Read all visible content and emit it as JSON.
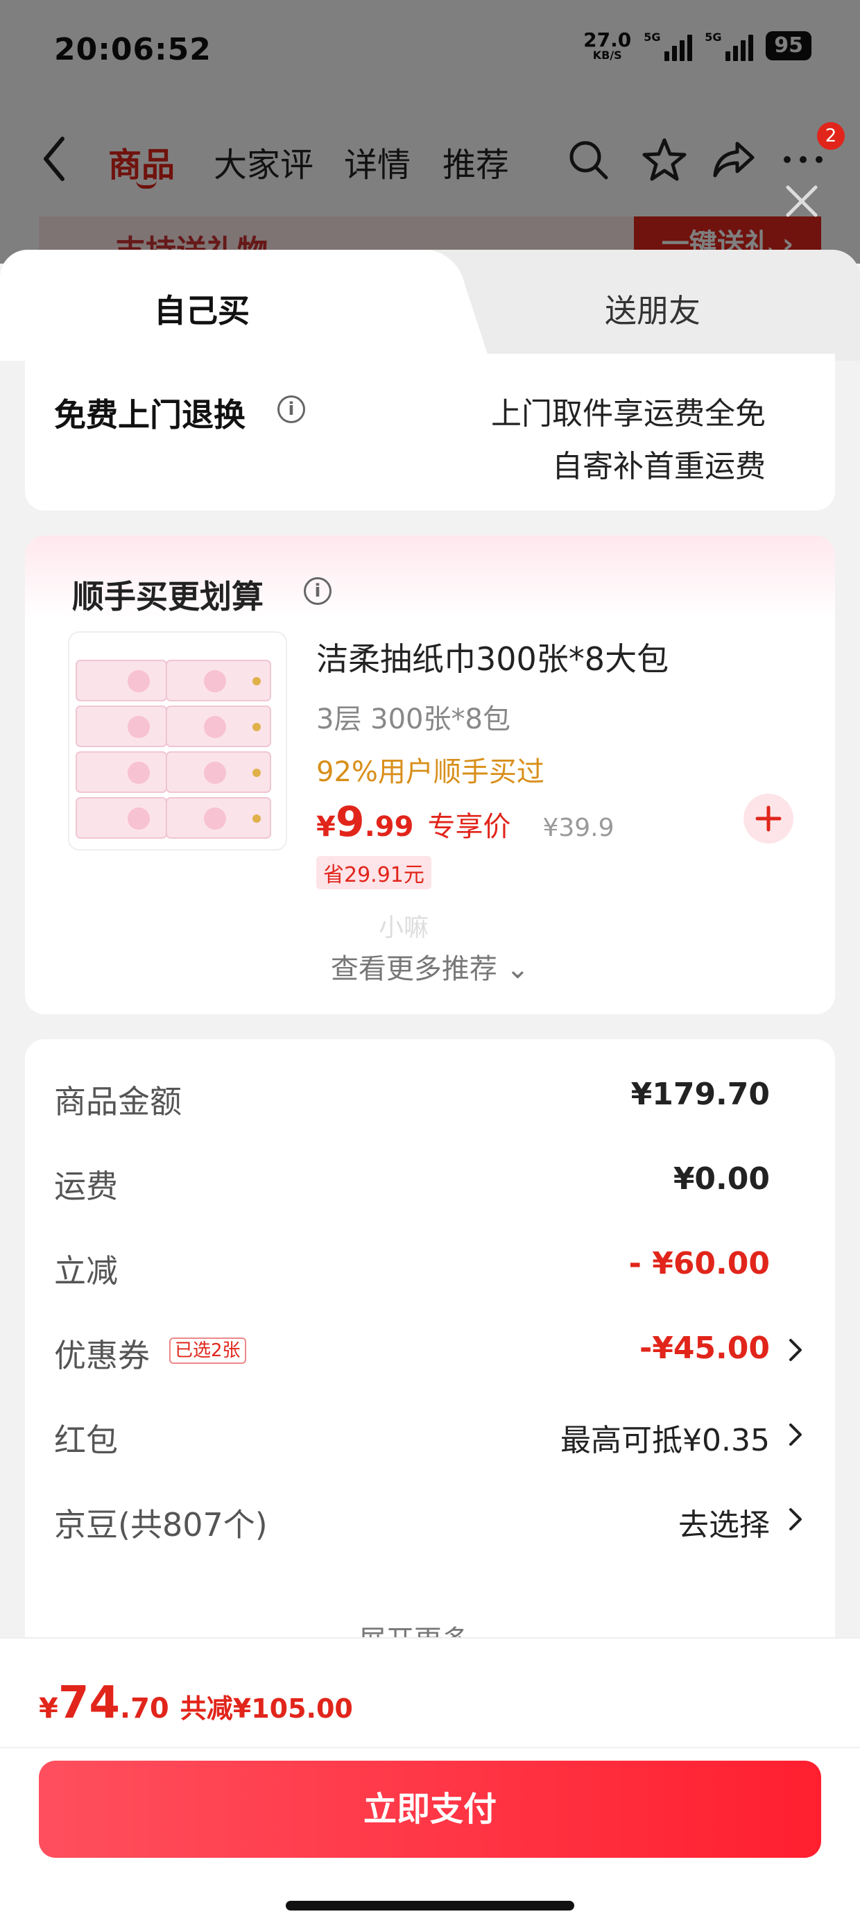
{
  "status_bar": {
    "time": "20:06:52",
    "net_speed": "27.0",
    "net_unit": "KB/S",
    "sim1": "5G",
    "sim2": "5G",
    "battery": "95"
  },
  "nav": {
    "tabs": [
      "商品",
      "大家评",
      "详情",
      "推荐"
    ],
    "active_tab": "商品",
    "badge_count": "2"
  },
  "gift_banner": {
    "label": "支持送礼物",
    "button": "一键送礼 ›"
  },
  "sheet_tabs": {
    "self_buy": "自己买",
    "gift_friend": "送朋友"
  },
  "return_service": {
    "title": "免费上门退换",
    "line1": "上门取件享运费全免",
    "line2": "自寄补首重运费"
  },
  "addon": {
    "title": "顺手买更划算",
    "product_name": "洁柔抽纸巾300张*8大包",
    "spec": "3层 300张*8包",
    "bought_rate": "92%用户顺手买过",
    "price_symbol": "¥",
    "price_int": "9",
    "price_dec": ".99",
    "price_label": "专享价",
    "original_price": "¥39.9",
    "save": "省29.91元",
    "watermark": "小嘛",
    "more": "查看更多推荐 ⌄"
  },
  "summary": {
    "rows": [
      {
        "key": "商品金额",
        "value": "¥179.70"
      },
      {
        "key": "运费",
        "value": "¥0.00"
      },
      {
        "key": "立减",
        "value": "- ¥60.00"
      },
      {
        "key": "优惠券",
        "tag": "已选2张",
        "value": "-¥45.00"
      },
      {
        "key": "红包",
        "value": "最高可抵¥0.35"
      },
      {
        "key": "京豆(共807个)",
        "value": "去选择"
      }
    ],
    "expand": "展开更多 ⌄"
  },
  "footer": {
    "total_symbol": "¥",
    "total_int": "74",
    "total_dec": ".70",
    "total_reduce": "共减¥105.00",
    "pay_button": "立即支付"
  },
  "colors": {
    "brand_red": "#e1251b",
    "orange": "#d88f1a"
  }
}
